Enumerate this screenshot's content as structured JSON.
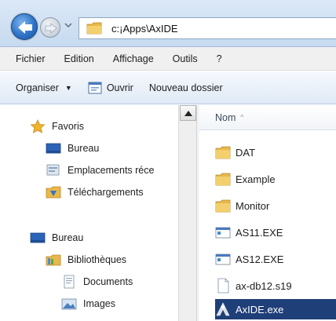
{
  "address_bar": {
    "path": "c:¡Apps\\AxIDE"
  },
  "menu": {
    "items": [
      "Fichier",
      "Edition",
      "Affichage",
      "Outils",
      "?"
    ]
  },
  "toolbar": {
    "organize_label": "Organiser",
    "open_label": "Ouvrir",
    "new_folder_label": "Nouveau dossier"
  },
  "nav_pane": {
    "favorites_label": "Favoris",
    "favorites": [
      {
        "label": "Bureau",
        "icon": "desktop-icon"
      },
      {
        "label": "Emplacements réce",
        "icon": "recent-places-icon"
      },
      {
        "label": "Téléchargements",
        "icon": "downloads-icon"
      }
    ],
    "desktop_label": "Bureau",
    "libraries_label": "Bibliothèques",
    "libraries": [
      {
        "label": "Documents",
        "icon": "documents-icon"
      },
      {
        "label": "Images",
        "icon": "images-icon"
      }
    ]
  },
  "file_list": {
    "column_name": "Nom",
    "items": [
      {
        "name": "DAT",
        "type": "folder"
      },
      {
        "name": "Example",
        "type": "folder"
      },
      {
        "name": "Monitor",
        "type": "folder"
      },
      {
        "name": "AS11.EXE",
        "type": "exe"
      },
      {
        "name": "AS12.EXE",
        "type": "exe"
      },
      {
        "name": "ax-db12.s19",
        "type": "file"
      },
      {
        "name": "AxIDE.exe",
        "type": "app",
        "selected": true
      }
    ]
  },
  "colors": {
    "selection": "#1f3f78",
    "folder": "#e8b84a",
    "command_bar": "#dfe9f5"
  }
}
